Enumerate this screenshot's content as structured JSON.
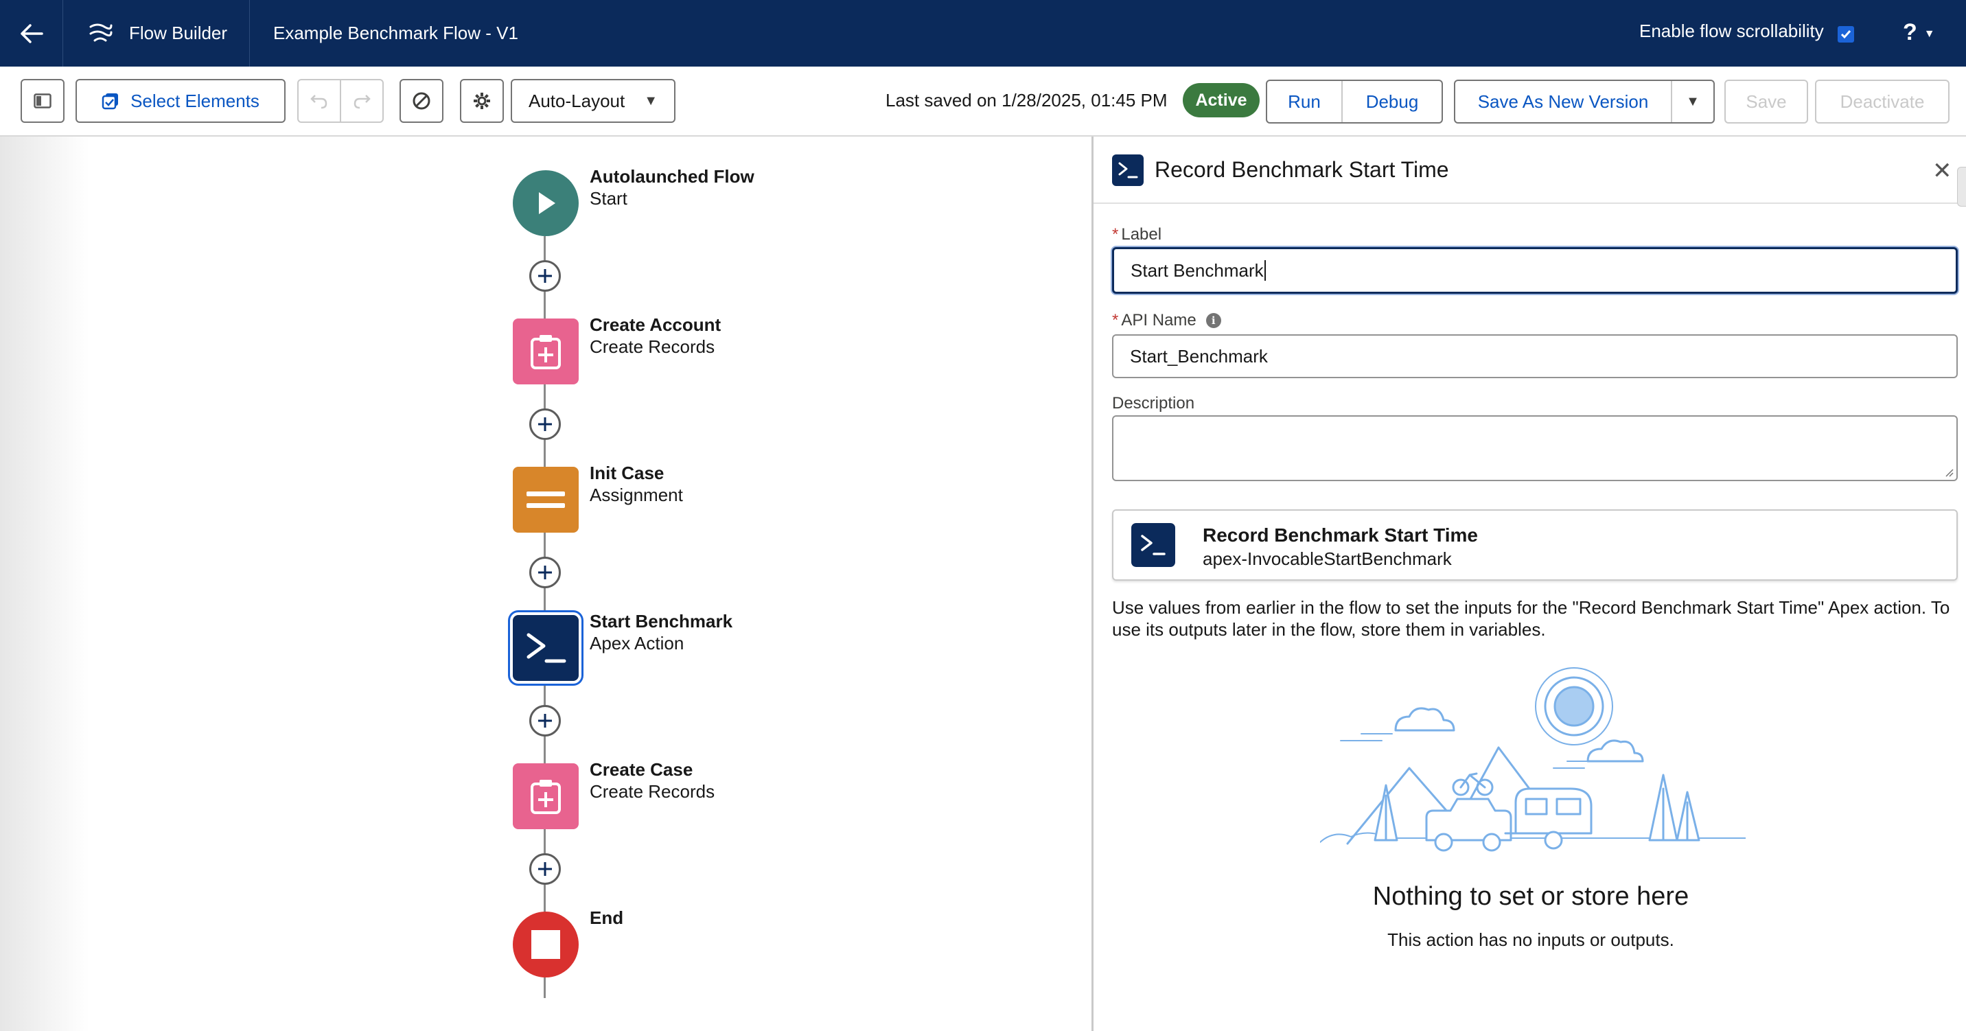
{
  "header": {
    "app_name": "Flow Builder",
    "flow_title": "Example Benchmark Flow - V1",
    "scrollability_label": "Enable flow scrollability",
    "scrollability_checked": true,
    "help_label": "?"
  },
  "toolbar": {
    "select_elements_label": "Select Elements",
    "layout_label": "Auto-Layout",
    "last_saved": "Last saved on 1/28/2025, 01:45 PM",
    "status_badge": "Active",
    "run_label": "Run",
    "debug_label": "Debug",
    "save_as_new_version_label": "Save As New Version",
    "save_label": "Save",
    "deactivate_label": "Deactivate"
  },
  "canvas": {
    "nodes": [
      {
        "title": "Autolaunched Flow",
        "subtitle": "Start",
        "color": "#3b8079",
        "icon": "play-icon"
      },
      {
        "title": "Create Account",
        "subtitle": "Create Records",
        "color": "#e8638f",
        "icon": "create-records-icon"
      },
      {
        "title": "Init Case",
        "subtitle": "Assignment",
        "color": "#d8862a",
        "icon": "assignment-icon"
      },
      {
        "title": "Start Benchmark",
        "subtitle": "Apex Action",
        "color": "#0b2a5b",
        "icon": "apex-action-icon"
      },
      {
        "title": "Create Case",
        "subtitle": "Create Records",
        "color": "#e8638f",
        "icon": "create-records-icon"
      },
      {
        "title": "End",
        "subtitle": "",
        "color": "#d9312f",
        "icon": "stop-icon"
      }
    ]
  },
  "panel": {
    "title": "Record Benchmark Start Time",
    "label_field_label": "Label",
    "label_value": "Start Benchmark",
    "api_name_label": "API Name",
    "api_name_value": "Start_Benchmark",
    "description_label": "Description",
    "description_value": "",
    "action_title": "Record Benchmark Start Time",
    "action_api": "apex-InvocableStartBenchmark",
    "help_text": "Use values from earlier in the flow to set the inputs for the \"Record Benchmark Start Time\" Apex action. To use its outputs later in the flow, store them in variables.",
    "empty_title": "Nothing to set or store here",
    "empty_subtitle": "This action has no inputs or outputs."
  },
  "colors": {
    "header_bg": "#0b2a5b",
    "link_blue": "#0a56c2",
    "active_green": "#3b7a3f"
  }
}
